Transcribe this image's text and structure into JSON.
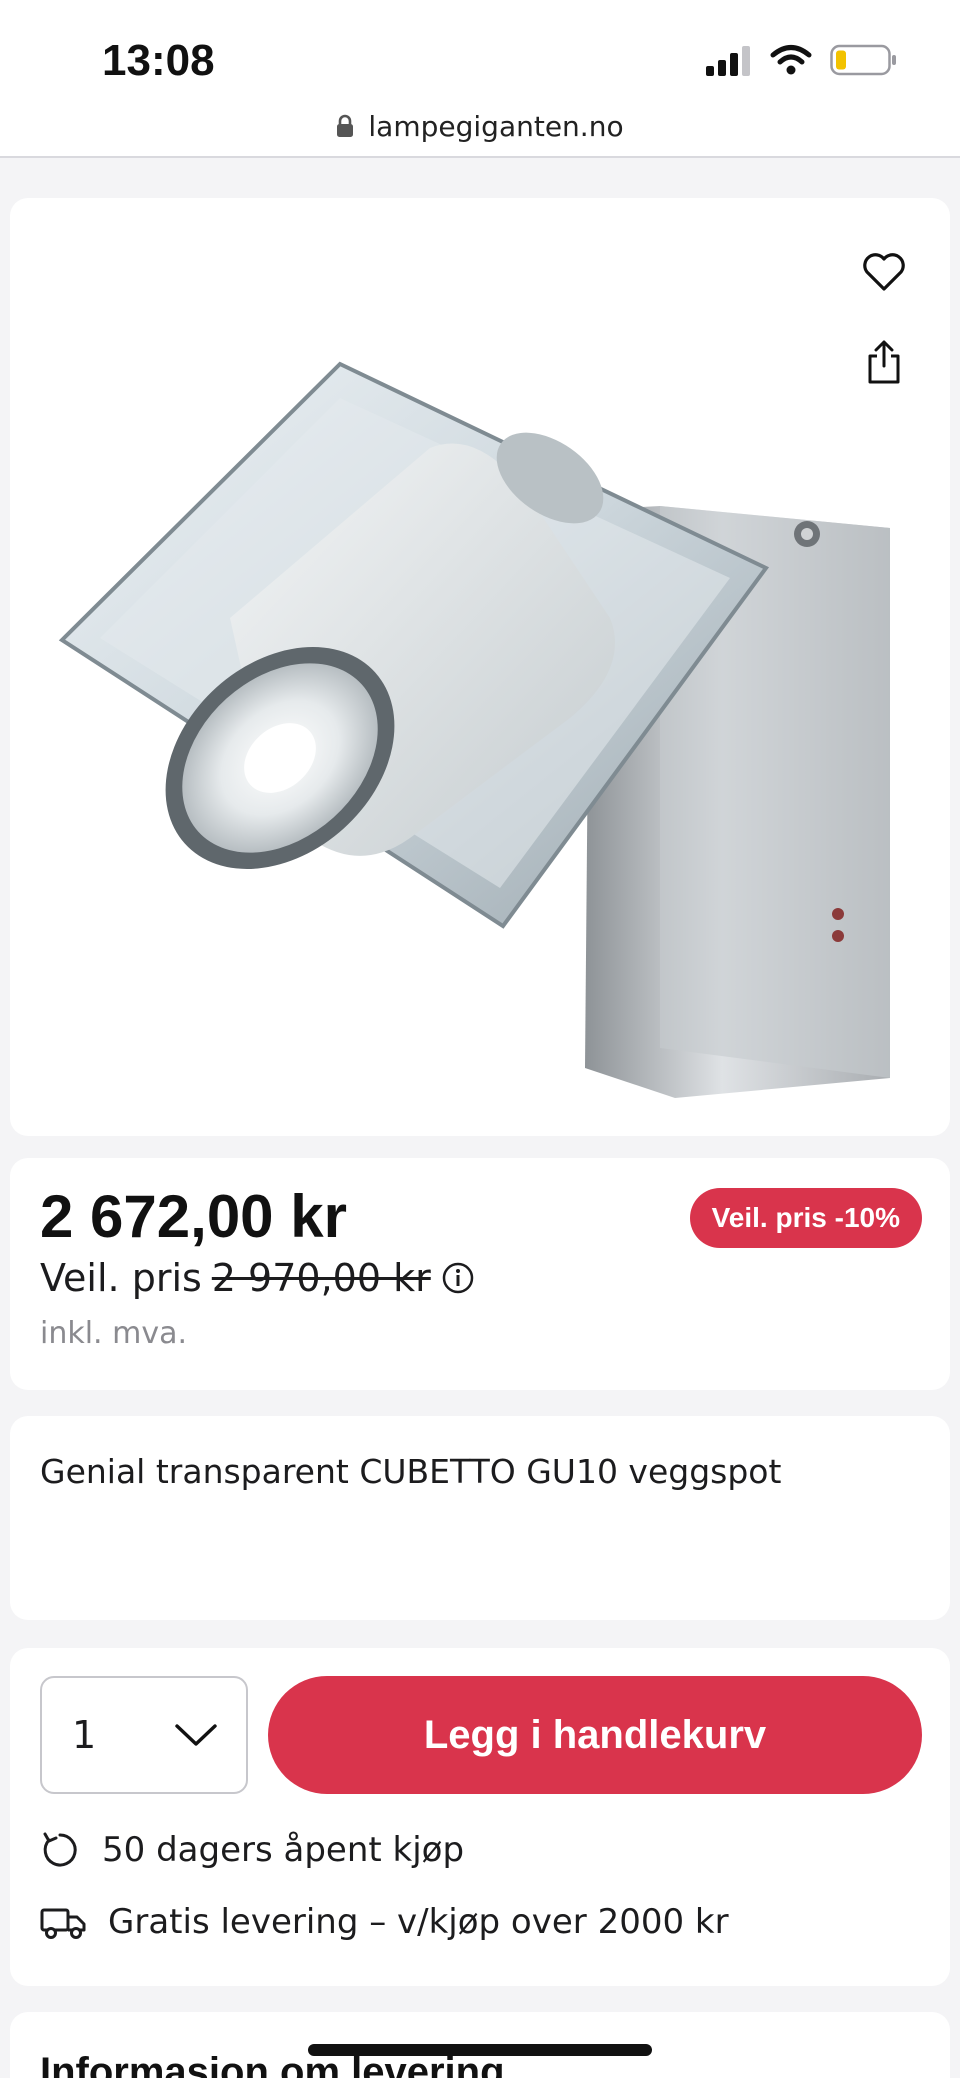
{
  "status_bar": {
    "time": "13:08",
    "icons": [
      "cellular-signal-icon",
      "wifi-icon",
      "battery-low-icon"
    ]
  },
  "browser": {
    "url": "lampegiganten.no",
    "icons": [
      "lock-icon"
    ]
  },
  "product": {
    "image_icons": [
      "heart-icon",
      "share-icon"
    ],
    "price": "2 672,00 kr",
    "recommended_label": "Veil. pris",
    "recommended_price": "2 970,00 kr",
    "vat_note": "inkl. mva.",
    "discount_badge": "Veil. pris -10%",
    "title": "Genial transparent CUBETTO GU10 veggspot"
  },
  "purchase": {
    "quantity": "1",
    "add_to_cart": "Legg i handlekurv",
    "features": [
      {
        "icon": "return-arrow-icon",
        "text": "50 dagers åpent kjøp"
      },
      {
        "icon": "delivery-truck-icon",
        "text": "Gratis levering – v/kjøp over 2000 kr"
      }
    ]
  },
  "info": {
    "title": "Informasjon om levering"
  },
  "colors": {
    "accent": "#d9344c",
    "page_background": "#f4f4f6",
    "card_background": "#ffffff",
    "muted_text": "#8a8a8f",
    "battery_level": "#f2c200"
  }
}
